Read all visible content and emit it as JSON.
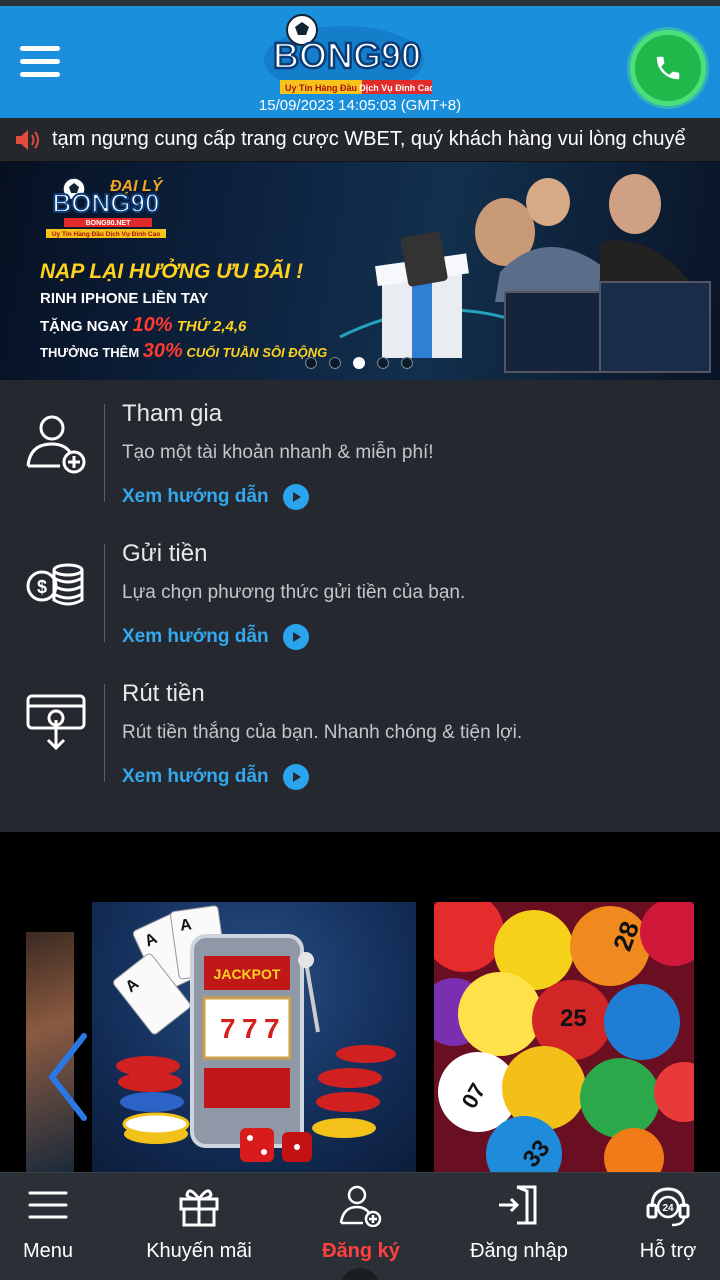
{
  "header": {
    "logo_text": "BONG90",
    "logo_tagline_left": "Uy Tín Hàng Đầu",
    "logo_tagline_right": "Dịch Vụ Đỉnh Cao",
    "datetime": "15/09/2023 14:05:03 (GMT+8)"
  },
  "marquee": {
    "text": "tạm ngưng cung cấp trang cược WBET, quý khách hàng vui lòng chuyể"
  },
  "banner": {
    "agency_label": "ĐẠI LÝ",
    "logo_text": "BONG90",
    "logo_domain": "BONG90.NET",
    "logo_tagline": "Uy Tín Hàng Đầu Dịch Vụ Đỉnh Cao",
    "headline": "NẠP LẠI HƯỞNG ƯU ĐÃI !",
    "line2": "RINH IPHONE LIỀN TAY",
    "line3_a": "TẶNG NGAY",
    "line3_pct": "10%",
    "line3_b": "THỨ 2,4,6",
    "line4_a": "THƯỞNG THÊM",
    "line4_pct": "30%",
    "line4_b": "CUỐI TUẦN SÔI ĐỘNG",
    "slide_count": 5,
    "active_slide": 3
  },
  "steps": [
    {
      "title": "Tham gia",
      "desc": "Tạo một tài khoản nhanh & miễn phí!",
      "guide": "Xem hướng dẫn"
    },
    {
      "title": "Gửi tiền",
      "desc": "Lựa chọn phương thức gửi tiền của bạn.",
      "guide": "Xem hướng dẫn"
    },
    {
      "title": "Rút tiền",
      "desc": "Rút tiền thắng của bạn. Nhanh chóng & tiện lợi.",
      "guide": "Xem hướng dẫn"
    }
  ],
  "games": {
    "slot_machine_text": "JACKPOT",
    "lotto_numbers": [
      "28",
      "25",
      "07",
      "33"
    ]
  },
  "bottom_nav": [
    {
      "label": "Menu",
      "icon": "menu-icon"
    },
    {
      "label": "Khuyến mãi",
      "icon": "gift-icon"
    },
    {
      "label": "Đăng ký",
      "icon": "add-user-icon",
      "active": true
    },
    {
      "label": "Đăng nhập",
      "icon": "login-icon"
    },
    {
      "label": "Hỗ trợ",
      "icon": "support-24-icon"
    }
  ],
  "colors": {
    "header_blue": "#1a90dc",
    "accent_link": "#33a8ee",
    "active_nav": "#ff4040",
    "panel_bg": "#25292f"
  }
}
